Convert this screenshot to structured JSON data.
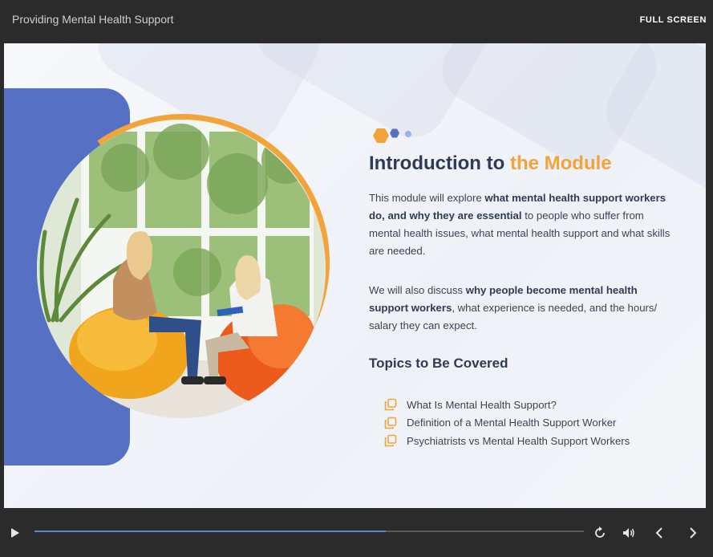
{
  "app": {
    "title": "Providing Mental Health Support",
    "fullscreen_label": "FULL SCREEN"
  },
  "slide": {
    "heading_part1": "Introduction to ",
    "heading_accent": "the Module",
    "paragraph1": {
      "text1": "This module will explore ",
      "bold": "what mental health support workers do, and why they are essential",
      "text2": " to people who suffer from mental health issues, what mental health support and what skills are needed."
    },
    "paragraph2": {
      "text1": "We will also discuss ",
      "bold": "why people become mental health support workers",
      "text2": ", what experience is needed, and the hours/ salary they can expect."
    },
    "topics_heading": "Topics to Be Covered",
    "topics": [
      {
        "label": "What Is Mental Health Support?",
        "icon": "copy-icon"
      },
      {
        "label": "Definition of a Mental Health Support Worker",
        "icon": "copy-icon"
      },
      {
        "label": "Psychiatrists vs Mental Health Support Workers",
        "icon": "copy-icon"
      }
    ],
    "photo": "two-women-talking-on-bean-bags"
  },
  "player": {
    "progress": 0.64,
    "icons": {
      "play": "play-icon",
      "replay": "replay-icon",
      "volume": "volume-icon",
      "prev": "chevron-left-icon",
      "next": "chevron-right-icon"
    }
  },
  "colors": {
    "accent_orange": "#f2a33a",
    "panel_blue": "#5671c4",
    "heading_dark": "#2f3a55",
    "progress_blue": "#5b87c8",
    "chrome_dark": "#2b2b2b"
  }
}
